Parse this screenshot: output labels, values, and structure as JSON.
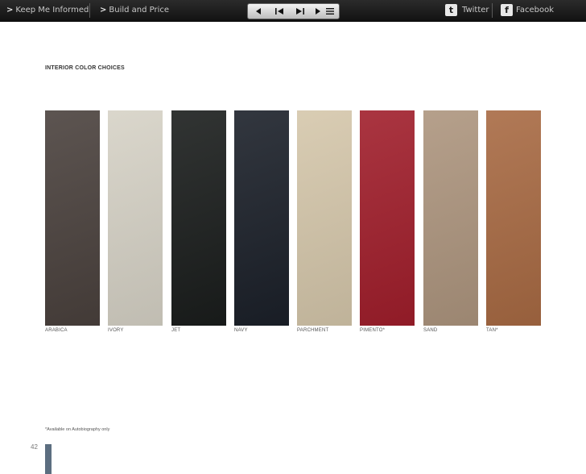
{
  "toolbar": {
    "keep_informed": "Keep Me Informed",
    "build_price": "Build and Price",
    "twitter": "Twitter",
    "facebook": "Facebook",
    "chevron": ">"
  },
  "page": {
    "heading": "INTERIOR COLOR CHOICES",
    "footnote": "*Available on Autobiography only",
    "page_number": "42"
  },
  "swatches": [
    {
      "name": "ARABICA",
      "color": "#4a413d"
    },
    {
      "name": "IVORY",
      "color": "#d6d2c6"
    },
    {
      "name": "JET",
      "color": "#1a1d1c"
    },
    {
      "name": "NAVY",
      "color": "#1b2029"
    },
    {
      "name": "PARCHMENT",
      "color": "#d5c7ab"
    },
    {
      "name": "PIMENTO*",
      "color": "#a01e2b"
    },
    {
      "name": "SAND",
      "color": "#ad957e"
    },
    {
      "name": "TAN*",
      "color": "#a86a43"
    }
  ]
}
